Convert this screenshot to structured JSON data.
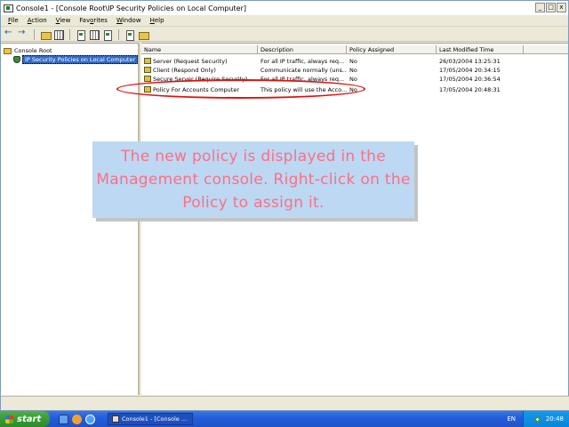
{
  "window": {
    "title": "Console1 - [Console Root\\IP Security Policies on Local Computer]",
    "buttons": [
      "_",
      "□",
      "x"
    ]
  },
  "menu": [
    {
      "prefix": "",
      "underline": "F",
      "rest": "ile"
    },
    {
      "prefix": "",
      "underline": "A",
      "rest": "ction"
    },
    {
      "prefix": "",
      "underline": "V",
      "rest": "iew"
    },
    {
      "prefix": "Fav",
      "underline": "o",
      "rest": "rites"
    },
    {
      "prefix": "",
      "underline": "W",
      "rest": "indow"
    },
    {
      "prefix": "",
      "underline": "H",
      "rest": "elp"
    }
  ],
  "tree": {
    "root": "Console Root",
    "child": "IP Security Policies on Local Computer"
  },
  "columns": [
    "Name",
    "Description",
    "Policy Assigned",
    "Last Modified Time"
  ],
  "rows": [
    {
      "name": "Server (Request Security)",
      "description": "For all IP traffic, always req...",
      "assigned": "No",
      "modified": "26/03/2004 13:25:31"
    },
    {
      "name": "Client (Respond Only)",
      "description": "Communicate normally (uns...",
      "assigned": "No",
      "modified": "17/05/2004 20:34:15"
    },
    {
      "name": "Secure Server (Require Security)",
      "description": "For all IP traffic, always req...",
      "assigned": "No",
      "modified": "17/05/2004 20:36:54"
    },
    {
      "name": "Policy For Accounts Computer",
      "description": "This policy will use the Acco...",
      "assigned": "No",
      "modified": "17/05/2004 20:48:31"
    }
  ],
  "callout": {
    "text": "The new policy is displayed in the Management console. Right-click on the Policy to assign it."
  },
  "taskbar": {
    "start": "start",
    "task_label": "Console1 - [Console ...",
    "language": "EN",
    "clock": "20:48"
  },
  "colors": {
    "callout_bg": "#bcd8f2",
    "callout_text": "#ff6e86",
    "highlight": "#e01010",
    "taskbar": "#245edc"
  }
}
